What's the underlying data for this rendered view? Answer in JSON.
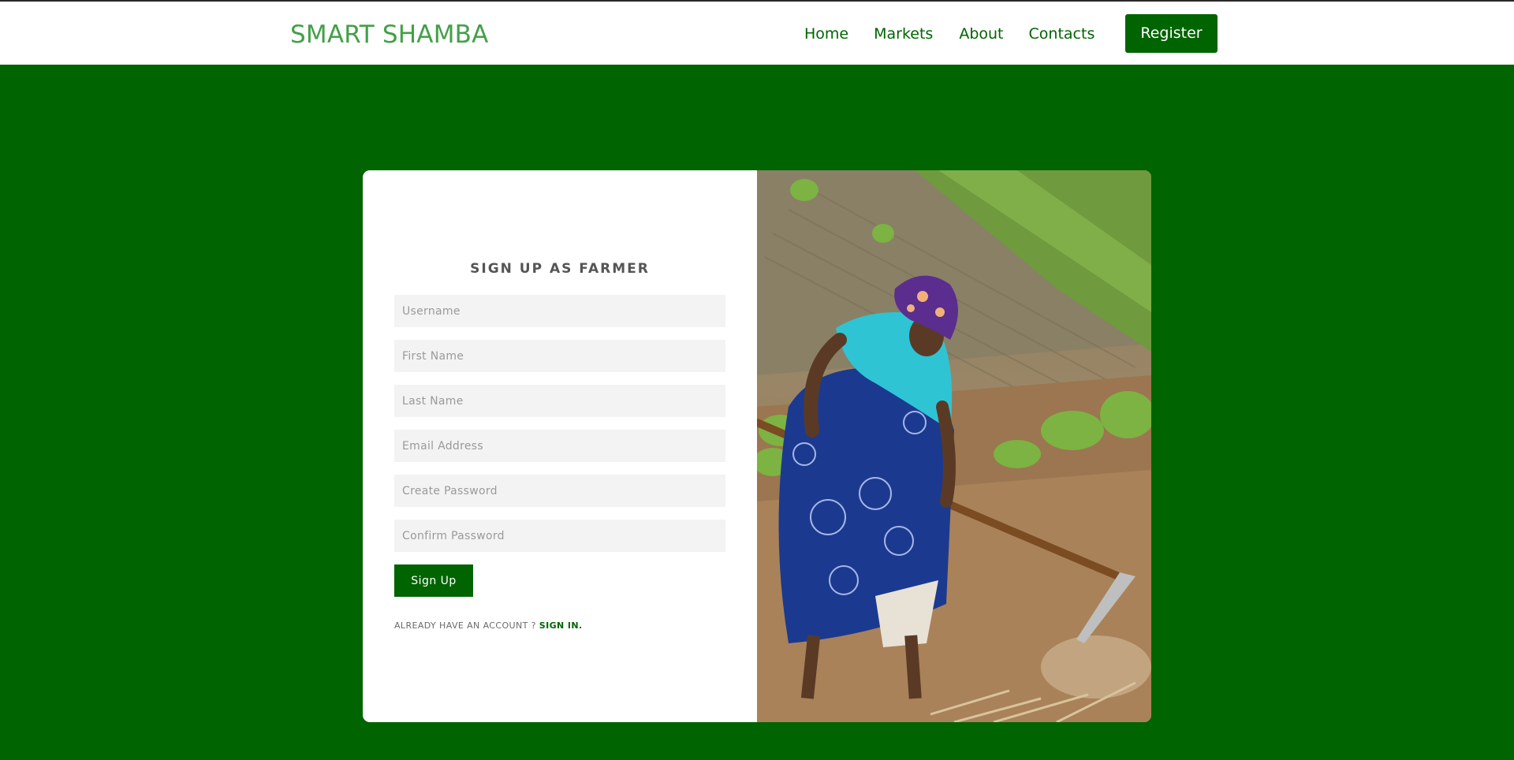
{
  "header": {
    "brand": "SMART SHAMBA",
    "nav": [
      "Home",
      "Markets",
      "About",
      "Contacts"
    ],
    "register_label": "Register"
  },
  "form": {
    "title": "SIGN UP AS FARMER",
    "fields": {
      "username": "Username",
      "first_name": "First Name",
      "last_name": "Last Name",
      "email": "Email Address",
      "create_password": "Create Password",
      "confirm_password": "Confirm Password"
    },
    "submit_label": "Sign Up",
    "account_prompt": "ALREADY HAVE AN ACCOUNT ?",
    "signin_label": "SIGN IN."
  },
  "colors": {
    "primary": "#006400",
    "brand": "#43a047",
    "background": "#006400",
    "card": "#ffffff",
    "input_bg": "#f3f3f3"
  }
}
